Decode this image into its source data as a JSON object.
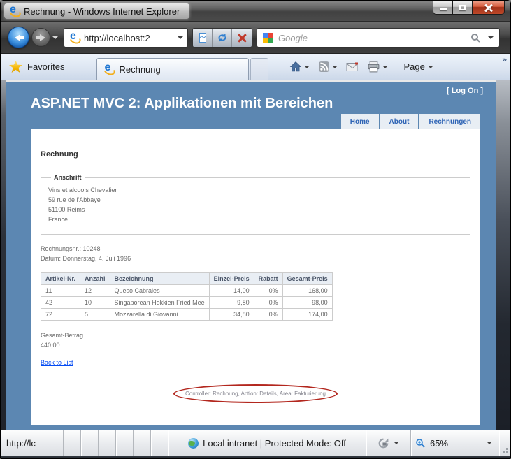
{
  "window": {
    "title": "Rechnung - Windows Internet Explorer"
  },
  "toolbar": {
    "address": "http://localhost:2",
    "search_placeholder": "Google"
  },
  "tabs_bar": {
    "favorites_label": "Favorites",
    "tab_title": "Rechnung",
    "page_menu_label": "Page",
    "overflow_chevron": "»"
  },
  "page": {
    "logon": {
      "open": "[",
      "label": "Log On",
      "close": "]"
    },
    "title": "ASP.NET MVC 2: Applikationen mit Bereichen",
    "nav": [
      "Home",
      "About",
      "Rechnungen"
    ],
    "content": {
      "heading": "Rechnung",
      "address": {
        "legend": "Anschrift",
        "lines": [
          "Vins et alcools Chevalier",
          "59 rue de l'Abbaye",
          "51100 Reims",
          "France"
        ]
      },
      "invoice_no": "Rechnungsnr.: 10248",
      "date": "Datum: Donnerstag, 4. Juli 1996",
      "table": {
        "headers": [
          "Artikel-Nr.",
          "Anzahl",
          "Bezeichnung",
          "Einzel-Preis",
          "Rabatt",
          "Gesamt-Preis"
        ],
        "rows": [
          [
            "11",
            "12",
            "Queso Cabrales",
            "14,00",
            "0%",
            "168,00"
          ],
          [
            "42",
            "10",
            "Singaporean Hokkien Fried Mee",
            "9,80",
            "0%",
            "98,00"
          ],
          [
            "72",
            "5",
            "Mozzarella di Giovanni",
            "34,80",
            "0%",
            "174,00"
          ]
        ]
      },
      "total_label": "Gesamt-Betrag",
      "total_value": "440,00",
      "back_link": "Back to List",
      "route_info": "Controller: Rechnung, Action: Details, Area: Fakturierung"
    }
  },
  "status_bar": {
    "url": "http://lc",
    "zone": "Local intranet | Protected Mode: Off",
    "zoom": "65%"
  },
  "colors": {
    "page_blue": "#5c87b2",
    "nav_button_bg": "#e8eef4",
    "nav_button_text": "#2e64b5",
    "link_blue": "#034af3",
    "annotation_red": "#b3271e"
  }
}
